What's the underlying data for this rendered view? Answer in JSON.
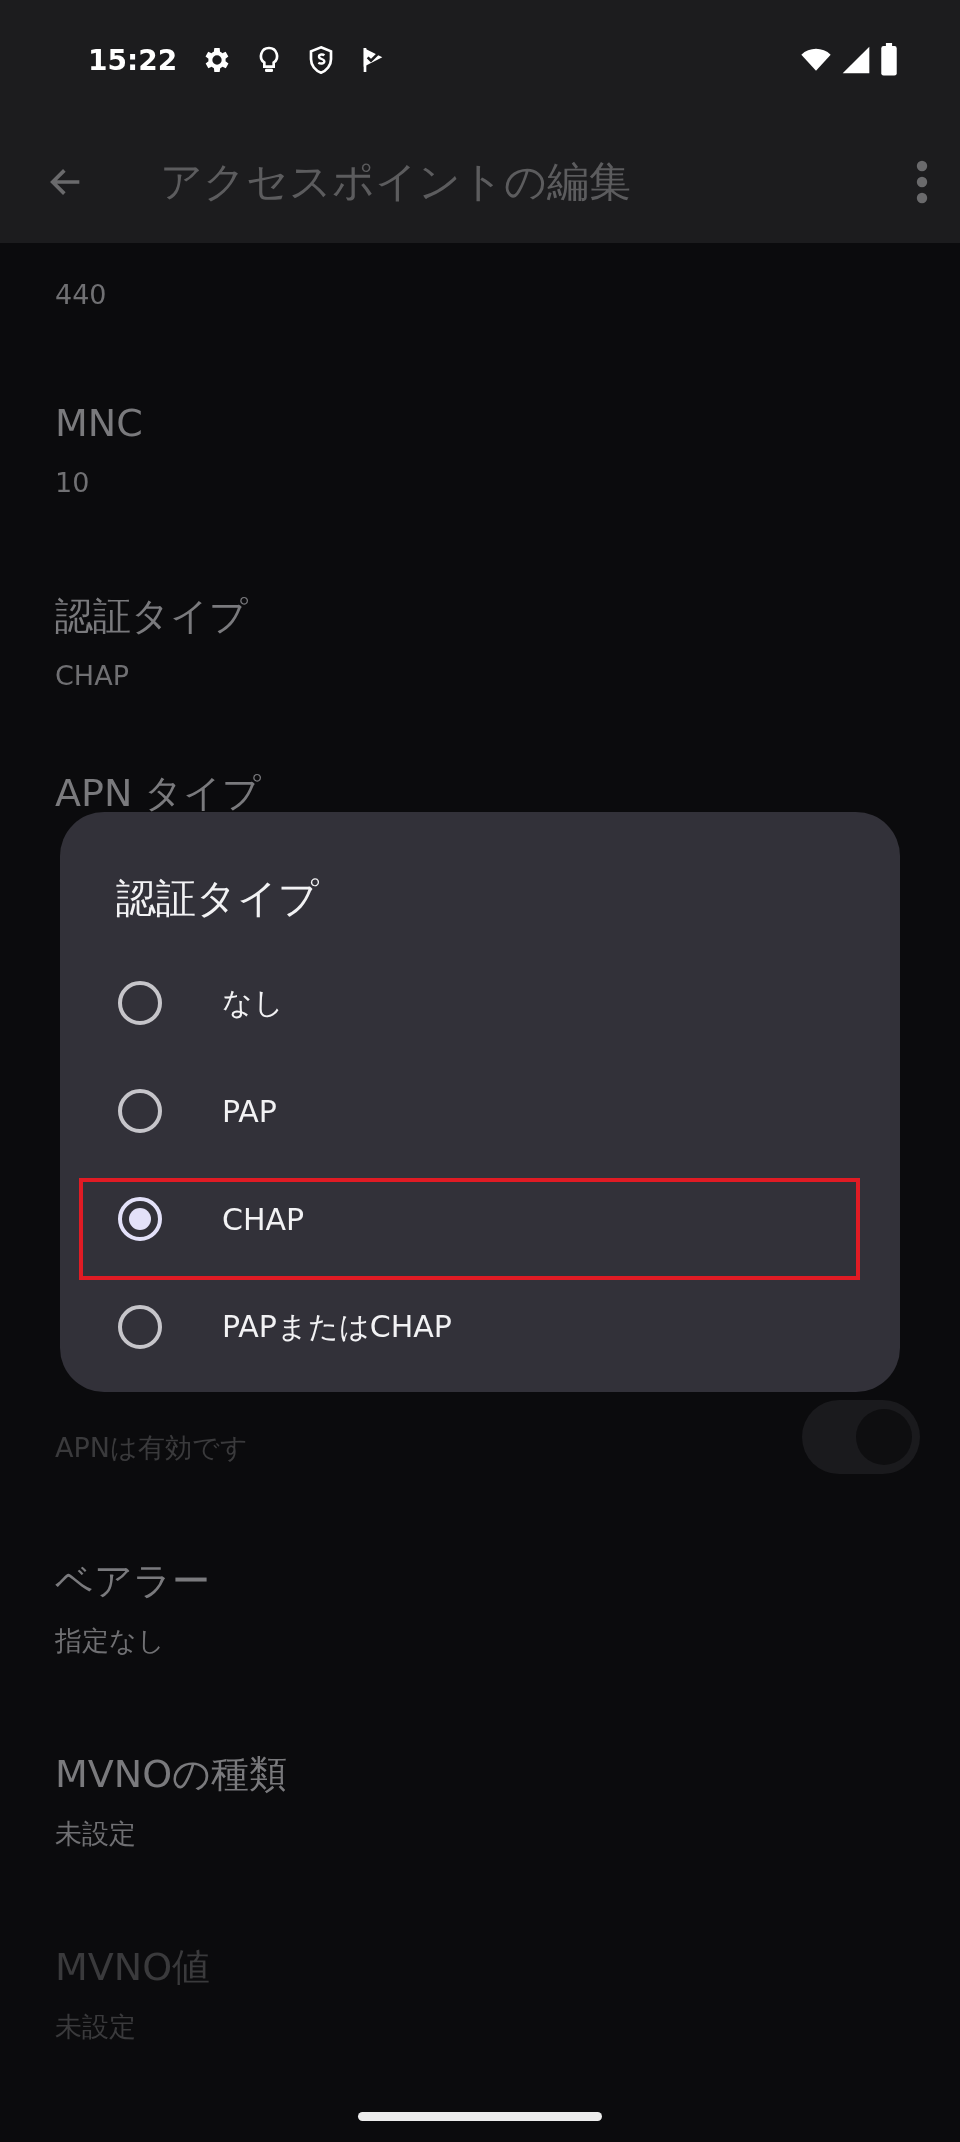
{
  "status_bar": {
    "time": "15:22"
  },
  "app_bar": {
    "title": "アクセスポイントの編集"
  },
  "settings_top": {
    "partial_value": "440",
    "items": [
      {
        "kind": "text",
        "label": "MNC",
        "value": "10",
        "disabled": false
      },
      {
        "kind": "text",
        "label": "認証タイプ",
        "value": "CHAP",
        "disabled": false
      },
      {
        "kind": "label_only",
        "label": "APN タイプ",
        "disabled": false
      }
    ]
  },
  "settings_bottom": [
    {
      "kind": "toggle",
      "value": "APNは有効です",
      "disabled": true,
      "on": true
    },
    {
      "kind": "text",
      "label": "ベアラー",
      "value": "指定なし",
      "disabled": false
    },
    {
      "kind": "text",
      "label": "MVNOの種類",
      "value": "未設定",
      "disabled": false
    },
    {
      "kind": "text",
      "label": "MVNO値",
      "value": "未設定",
      "disabled": true
    }
  ],
  "dialog": {
    "title": "認証タイプ",
    "options": [
      {
        "label": "なし",
        "selected": false,
        "highlighted": false
      },
      {
        "label": "PAP",
        "selected": false,
        "highlighted": false
      },
      {
        "label": "CHAP",
        "selected": true,
        "highlighted": true
      },
      {
        "label": "PAPまたはCHAP",
        "selected": false,
        "highlighted": false
      }
    ]
  }
}
